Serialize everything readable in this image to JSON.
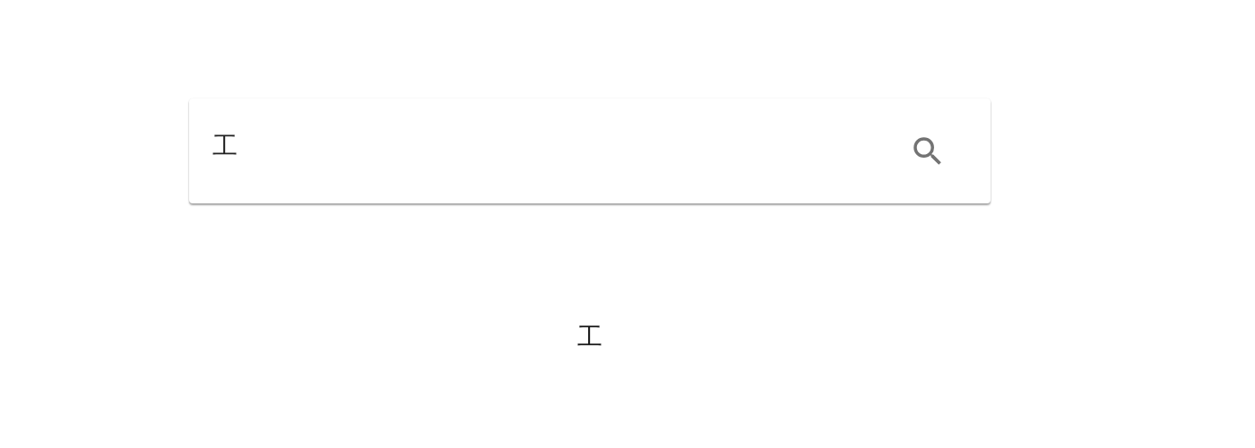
{
  "search": {
    "value": "工"
  },
  "result": {
    "text": "工"
  }
}
